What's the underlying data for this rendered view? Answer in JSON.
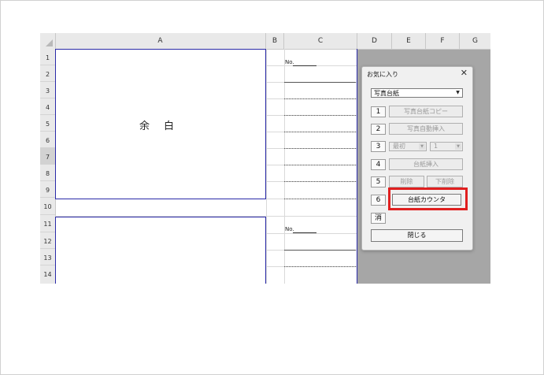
{
  "sheet": {
    "columns": [
      "A",
      "B",
      "C",
      "D",
      "E",
      "F",
      "G"
    ],
    "rows": [
      "1",
      "2",
      "3",
      "4",
      "5",
      "6",
      "7",
      "8",
      "9",
      "10",
      "11",
      "12",
      "13",
      "14"
    ],
    "cellA_text": "余白",
    "no_label_1": "No.",
    "no_label_2": "No."
  },
  "dialog": {
    "title": "お気に入り",
    "close_glyph": "✕",
    "dropdown_value": "写真台紙",
    "dropdown_arrow": "▼",
    "numbers": [
      "1",
      "2",
      "3",
      "4",
      "5",
      "6"
    ],
    "clear_label": "消",
    "copy_label": "写真台紙コピー",
    "auto_insert_label": "写真自動挿入",
    "first_select": "最初",
    "count_select": "1",
    "insert_label": "台紙挿入",
    "delete_label": "削除",
    "delete_below_label": "下削除",
    "counter_label": "台紙カウンタ",
    "close_label": "閉じる"
  },
  "colors": {
    "selection_border": "#2a2aa8",
    "highlight": "#e01f1f",
    "dark_area": "#a6a6a6"
  }
}
